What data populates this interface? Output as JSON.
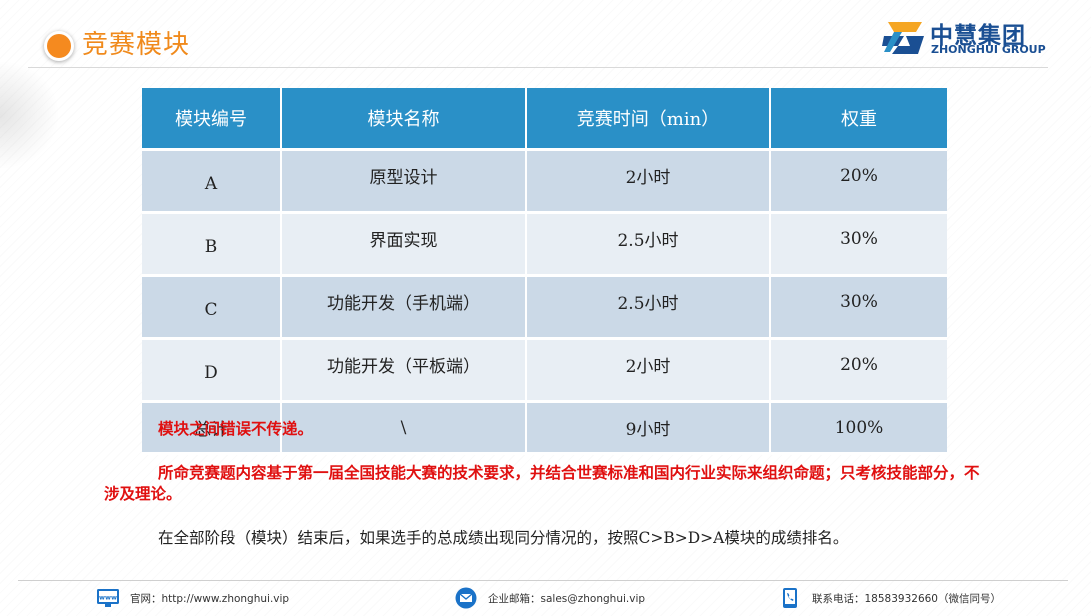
{
  "header": {
    "title": "竞赛模块",
    "logo_cn": "中慧集团",
    "logo_en": "ZHONGHUI GROUP"
  },
  "table": {
    "headers": [
      "模块编号",
      "模块名称",
      "竞赛时间（min）",
      "权重"
    ],
    "rows": [
      [
        "A",
        "原型设计",
        "2小时",
        "20%"
      ],
      [
        "B",
        "界面实现",
        "2.5小时",
        "30%"
      ],
      [
        "C",
        "功能开发（手机端）",
        "2.5小时",
        "30%"
      ],
      [
        "D",
        "功能开发（平板端）",
        "2小时",
        "20%"
      ],
      [
        "总计",
        "\\",
        "9小时",
        "100%"
      ]
    ]
  },
  "notes": {
    "n1": "模块之间错误不传递。",
    "n2": "所命竞赛题内容基于第一届全国技能大赛的技术要求，并结合世赛标准和国内行业实际来组织命题；只考核技能部分，不涉及理论。",
    "n3": "在全部阶段（模块）结束后，如果选手的总成绩出现同分情况的，按照C>B>D>A模块的成绩排名。"
  },
  "footer": {
    "web_icon_text": "www",
    "website": "官网：http://www.zhonghui.vip",
    "email": "企业邮箱：sales@zhonghui.vip",
    "phone": "联系电话：18583932660（微信同号）"
  },
  "colors": {
    "accent_orange": "#f08a1c",
    "header_blue": "#2a90c7",
    "row_dark": "#cbd9e7",
    "row_light": "#e8eef4",
    "note_red": "#e01010",
    "logo_blue": "#1a4f93"
  }
}
